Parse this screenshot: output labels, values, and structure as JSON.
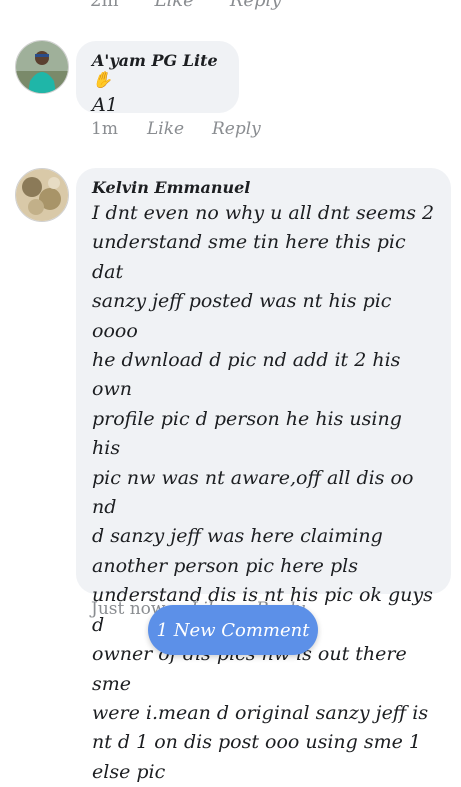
{
  "top_actions": {
    "time": "2m",
    "like": "Like",
    "reply": "Reply"
  },
  "comments": [
    {
      "author": "A'yam PG Lite",
      "text": "A1",
      "time": "1m",
      "like": "Like",
      "reply": "Reply"
    },
    {
      "author": "Kelvin Emmanuel",
      "lines": [
        "I dnt even no why u all dnt seems 2",
        "understand sme tin here this pic dat",
        "sanzy jeff posted was nt his pic oooo",
        "he dwnload d pic nd add it 2 his own",
        "profile pic d person he his using his",
        "pic nw was nt aware,off all dis oo nd",
        "d sanzy jeff was here claiming",
        "another person pic here pls",
        "understand dis is nt his pic ok guys d",
        "owner of dis pics nw is out there sme",
        "were i.mean d original sanzy jeff is",
        "nt d 1 on dis post ooo using  sme 1",
        "else pic"
      ],
      "time": "Just now",
      "like": "Like",
      "reply": "Reply"
    }
  ],
  "new_comment_label": "1 New Comment",
  "colors": {
    "bubble": "#f0f2f5",
    "meta": "#8a8d91",
    "pill": "#5c90e8"
  }
}
